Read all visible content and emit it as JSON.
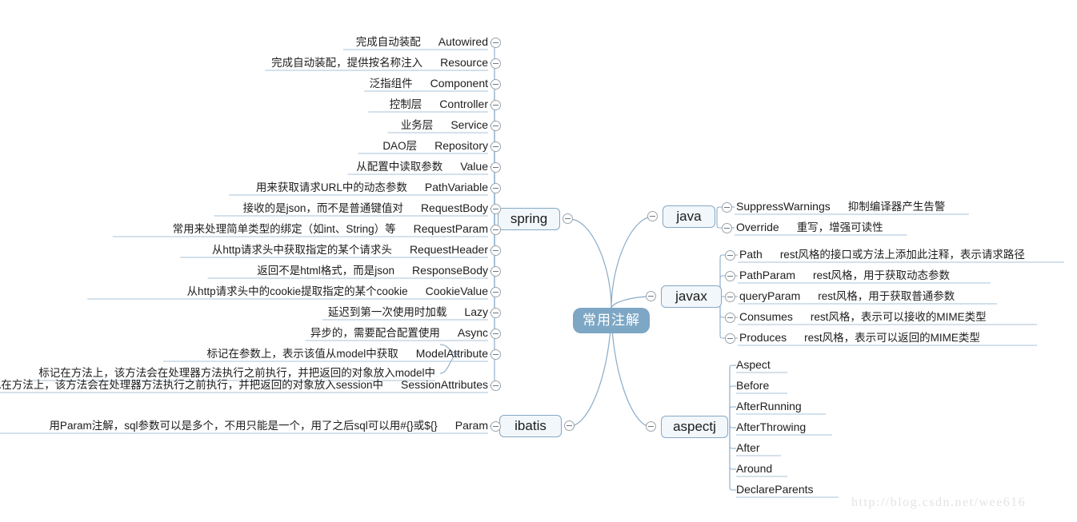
{
  "center": {
    "label": "常用注解"
  },
  "watermark": "http://blog.csdn.net/wee616",
  "branches": {
    "spring": {
      "label": "spring",
      "items": [
        {
          "name": "Autowired",
          "desc": "完成自动装配"
        },
        {
          "name": "Resource",
          "desc": "完成自动装配，提供按名称注入"
        },
        {
          "name": "Component",
          "desc": "泛指组件"
        },
        {
          "name": "Controller",
          "desc": "控制层"
        },
        {
          "name": "Service",
          "desc": "业务层"
        },
        {
          "name": "Repository",
          "desc": "DAO层"
        },
        {
          "name": "Value",
          "desc": "从配置中读取参数"
        },
        {
          "name": "PathVariable",
          "desc": "用来获取请求URL中的动态参数"
        },
        {
          "name": "RequestBody",
          "desc": "接收的是json，而不是普通键值对"
        },
        {
          "name": "RequestParam",
          "desc": "常用来处理简单类型的绑定（如int、String）等"
        },
        {
          "name": "RequestHeader",
          "desc": "从http请求头中获取指定的某个请求头"
        },
        {
          "name": "ResponseBody",
          "desc": "返回不是html格式，而是json"
        },
        {
          "name": "CookieValue",
          "desc": "从http请求头中的cookie提取指定的某个cookie"
        },
        {
          "name": "Lazy",
          "desc": "延迟到第一次使用时加载"
        },
        {
          "name": "Async",
          "desc": "异步的，需要配合配置使用"
        },
        {
          "name": "ModelAttribute",
          "desc": "标记在参数上，表示该值从model中获取",
          "desc2": "标记在方法上，该方法会在处理器方法执行之前执行，并把返回的对象放入model中"
        },
        {
          "name": "SessionAttributes",
          "desc": "标记在方法上，该方法会在处理器方法执行之前执行，并把返回的对象放入session中"
        }
      ]
    },
    "ibatis": {
      "label": "ibatis",
      "items": [
        {
          "name": "Param",
          "desc": "用Param注解，sql参数可以是多个，不用只能是一个，用了之后sql可以用#{}或${}"
        }
      ]
    },
    "java": {
      "label": "java",
      "items": [
        {
          "name": "SuppressWarnings",
          "desc": "抑制编译器产生告警"
        },
        {
          "name": "Override",
          "desc": "重写，增强可读性"
        }
      ]
    },
    "javax": {
      "label": "javax",
      "items": [
        {
          "name": "Path",
          "desc": "rest风格的接口或方法上添加此注释，表示请求路径"
        },
        {
          "name": "PathParam",
          "desc": "rest风格，用于获取动态参数"
        },
        {
          "name": "queryParam",
          "desc": "rest风格，用于获取普通参数"
        },
        {
          "name": "Consumes",
          "desc": "rest风格，表示可以接收的MIME类型"
        },
        {
          "name": "Produces",
          "desc": "rest风格，表示可以返回的MIME类型"
        }
      ]
    },
    "aspectj": {
      "label": "aspectj",
      "items": [
        {
          "name": "Aspect",
          "desc": ""
        },
        {
          "name": "Before",
          "desc": ""
        },
        {
          "name": "AfterRunning",
          "desc": ""
        },
        {
          "name": "AfterThrowing",
          "desc": ""
        },
        {
          "name": "After",
          "desc": ""
        },
        {
          "name": "Around",
          "desc": ""
        },
        {
          "name": "DeclareParents",
          "desc": ""
        }
      ]
    }
  },
  "colors": {
    "center_bg": "#7da7c4",
    "node_bg": "#f2f7fb",
    "node_border": "#85a8c4",
    "link": "#8aabc6",
    "underline": "#a9c3d8",
    "text": "#1d1d1d",
    "watermark": "#e3e3e3"
  }
}
